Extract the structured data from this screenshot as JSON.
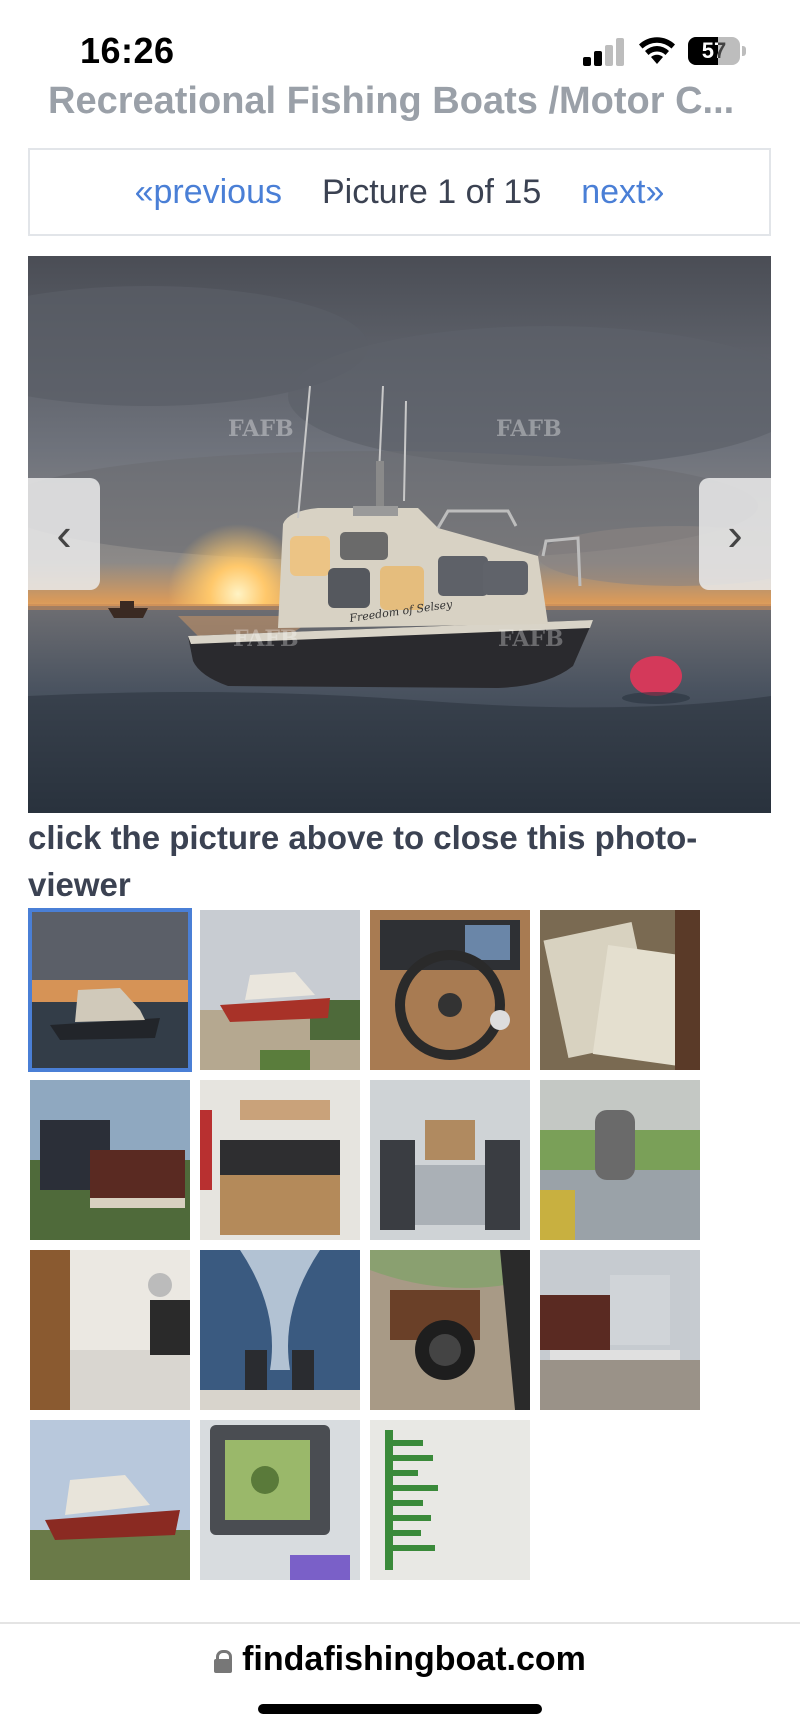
{
  "status_bar": {
    "time": "16:26",
    "battery_level": "57",
    "signal_icon": "cellular-signal-icon",
    "wifi_icon": "wifi-icon",
    "battery_icon": "battery-icon"
  },
  "page": {
    "title": "Recreational Fishing Boats /Motor C..."
  },
  "pager": {
    "previous_label": "«previous",
    "counter_label": "Picture 1 of 15",
    "next_label": "next»"
  },
  "viewer": {
    "prev_arrow": "‹",
    "next_arrow": "›",
    "watermark": "FAFB",
    "boat_name": "Freedom of Selsey"
  },
  "hint": {
    "text": "click the picture above to close this photo-viewer"
  },
  "thumbnails": {
    "count": 15,
    "selected_index": 0,
    "items": [
      "sunset-boat",
      "boat-on-trailer",
      "helm-wheel",
      "documents",
      "outboard-engines",
      "cabin-interior",
      "cabin-seats",
      "deck-winch",
      "cabin-galley",
      "wake-outboards",
      "compass",
      "trailer-rear",
      "boat-trailer-side",
      "fish-finder",
      "printed-list"
    ]
  },
  "browser": {
    "url": "findafishingboat.com",
    "lock_icon": "lock-icon"
  },
  "colors": {
    "link": "#4a7fd6",
    "text": "#3b4252",
    "title_muted": "#9aa0a8",
    "selected_outline": "#4a7fd6"
  }
}
